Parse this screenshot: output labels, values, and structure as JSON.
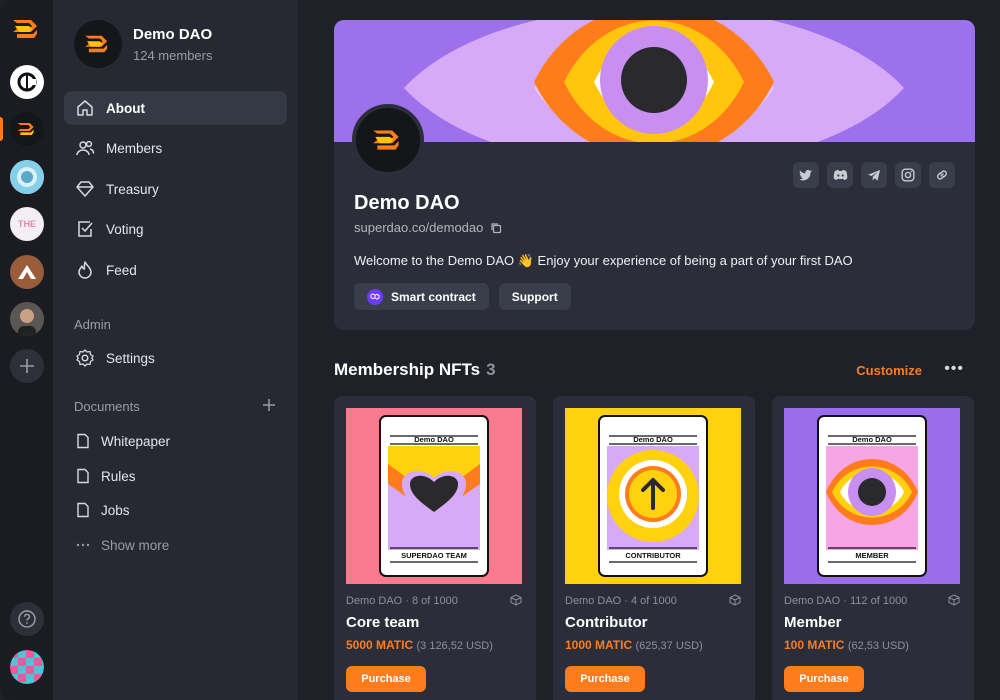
{
  "colors": {
    "accent": "#fe7c1c",
    "bg": "#1f2128",
    "sidebar": "#262932",
    "card": "#2b2e38"
  },
  "rail": {
    "items": [
      {
        "name": "superdao-logo-icon"
      },
      {
        "name": "coin-dao-icon"
      },
      {
        "name": "demo-dao-icon"
      },
      {
        "name": "globe-dao-icon"
      },
      {
        "name": "the-dao-icon",
        "label": "THE"
      },
      {
        "name": "mountain-dao-icon"
      },
      {
        "name": "person-dao-icon"
      },
      {
        "name": "add-icon"
      },
      {
        "name": "help-icon"
      },
      {
        "name": "user-avatar"
      }
    ]
  },
  "sidebar": {
    "org_name": "Demo DAO",
    "org_members": "124 members",
    "nav": [
      {
        "label": "About",
        "icon": "home-icon"
      },
      {
        "label": "Members",
        "icon": "users-icon"
      },
      {
        "label": "Treasury",
        "icon": "diamond-icon"
      },
      {
        "label": "Voting",
        "icon": "vote-icon"
      },
      {
        "label": "Feed",
        "icon": "flame-icon"
      }
    ],
    "admin_label": "Admin",
    "settings_label": "Settings",
    "documents_label": "Documents",
    "docs": [
      "Whitepaper",
      "Rules",
      "Jobs"
    ],
    "show_more": "Show more"
  },
  "profile": {
    "name": "Demo DAO",
    "url": "superdao.co/demodao",
    "description": "Welcome to the Demo DAO 👋 Enjoy your experience of being a part of your first DAO",
    "smart_contract_label": "Smart contract",
    "support_label": "Support",
    "socials": [
      "twitter-icon",
      "discord-icon",
      "telegram-icon",
      "instagram-icon",
      "link-icon"
    ]
  },
  "nfts": {
    "title": "Membership NFTs",
    "count": "3",
    "customize_label": "Customize",
    "more_label": "•••",
    "cards": [
      {
        "art_dao": "Demo DAO",
        "art_tier": "SUPERDAO TEAM",
        "meta": "Demo DAO · 8 of 1000",
        "name": "Core team",
        "price": "5000 MATIC",
        "usd": "(3 126,52 USD)",
        "buy": "Purchase",
        "art_bg": "#f97a8c"
      },
      {
        "art_dao": "Demo DAO",
        "art_tier": "CONTRIBUTOR",
        "meta": "Demo DAO · 4 of 1000",
        "name": "Contributor",
        "price": "1000 MATIC",
        "usd": "(625,37 USD)",
        "buy": "Purchase",
        "art_bg": "#ffd10e"
      },
      {
        "art_dao": "Demo DAO",
        "art_tier": "MEMBER",
        "meta": "Demo DAO · 112 of 1000",
        "name": "Member",
        "price": "100 MATIC",
        "usd": "(62,53 USD)",
        "buy": "Purchase",
        "art_bg": "#9b6cec"
      }
    ]
  }
}
